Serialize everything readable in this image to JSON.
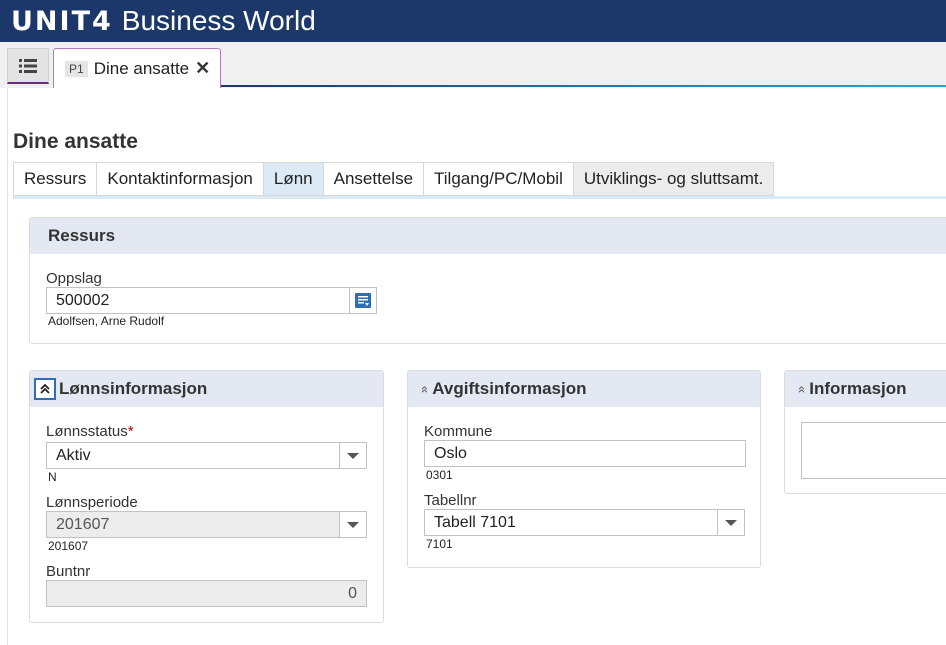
{
  "app": {
    "brand": "UNIT4",
    "product": "Business World"
  },
  "tabbar": {
    "menu_icon": "list-icon",
    "doc_tab": {
      "badge": "P1",
      "label": "Dine ansatte",
      "close": "✕"
    }
  },
  "page": {
    "title": "Dine ansatte"
  },
  "section_tabs": [
    "Ressurs",
    "Kontaktinformasjon",
    "Lønn",
    "Ansettelse",
    "Tilgang/PC/Mobil",
    "Utviklings- og sluttsamt."
  ],
  "active_tab": "Lønn",
  "ressurs": {
    "title": "Ressurs",
    "lookup_label": "Oppslag",
    "lookup_value": "500002",
    "lookup_name": "Adolfsen, Arne Rudolf",
    "lookup_icon": "lookup-list-icon"
  },
  "lonn": {
    "title": "Lønnsinformasjon",
    "collapse_icon": "double-chevron-up-icon",
    "status_label": "Lønnsstatus",
    "required_mark": "*",
    "status_value": "Aktiv",
    "status_code": "N",
    "period_label": "Lønnsperiode",
    "period_value": "201607",
    "period_code": "201607",
    "bunt_label": "Buntnr",
    "bunt_value": "0"
  },
  "avgift": {
    "title": "Avgiftsinformasjon",
    "chevron": "»",
    "kommune_label": "Kommune",
    "kommune_value": "Oslo",
    "kommune_code": "0301",
    "tabell_label": "Tabellnr",
    "tabell_value": "Tabell 7101",
    "tabell_code": "7101"
  },
  "info": {
    "title": "Informasjon",
    "chevron": "»",
    "text": ""
  },
  "colors": {
    "header": "#1c3769",
    "panel_head": "#e3e8f2",
    "active_tab": "#dceaf5",
    "lookup_button": "#2f6db5"
  }
}
